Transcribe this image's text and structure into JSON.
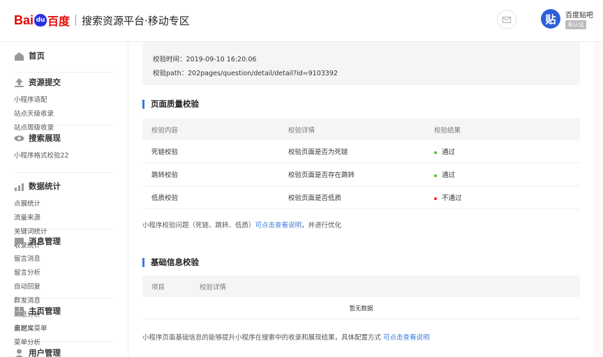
{
  "header": {
    "logo_bai": "Bai",
    "logo_du": "du",
    "logo_cn": "百度",
    "platform_title": "搜索资源平台·移动专区",
    "user_avatar_char": "贴",
    "user_name": "百度贴吧",
    "user_badge": "未认证"
  },
  "sidebar": {
    "home": "首页",
    "resource": {
      "title": "资源提交",
      "items": [
        "小程序适配",
        "站点天级收录",
        "站点周级收录"
      ]
    },
    "search": {
      "title": "搜索展现",
      "items": [
        "小程序格式校验22"
      ]
    },
    "data": {
      "title": "数据统计",
      "items": [
        "点展统计",
        "流量来源",
        "关键词统计",
        "收录统计"
      ]
    },
    "message": {
      "title": "消息管理",
      "items": [
        "留言消息",
        "留言分析",
        "自动回复",
        "群发消息",
        "消息分析",
        "素材库"
      ]
    },
    "homepage": {
      "title": "主页管理",
      "items": [
        "自定义菜单",
        "菜单分析"
      ]
    },
    "user": {
      "title": "用户管理"
    }
  },
  "main": {
    "check_time_label": "校验时间：",
    "check_time_value": "2019-09-10 16:20:06",
    "check_path_label": "校验path：",
    "check_path_value": "202pages/question/detail/detail?id=9103392",
    "quality": {
      "title": "页面质量校验",
      "columns": [
        "校验内容",
        "校验详情",
        "校验结果"
      ],
      "rows": [
        {
          "content": "死链校验",
          "detail": "校验页面是否为死链",
          "result": "通过",
          "status": "pass"
        },
        {
          "content": "跳转校验",
          "detail": "校验页面是否存在跳转",
          "result": "通过",
          "status": "pass"
        },
        {
          "content": "低质校验",
          "detail": "校验页面是否低质",
          "result": "不通过",
          "status": "fail"
        }
      ],
      "note_prefix": "小程序校验问题（死链、跳转、低质）",
      "note_link": "可点击查看说明",
      "note_suffix": "，并进行优化"
    },
    "basic": {
      "title": "基础信息校验",
      "columns": [
        "项目",
        "校验详情"
      ],
      "empty_text": "暂无数据",
      "note_prefix": "小程序页面基础信息的能够提升小程序在搜索中的收录和展现结果，具体配置方式",
      "note_link": "可点击查看说明"
    }
  },
  "colors": {
    "pass": "#52c41a",
    "fail": "#f5222d",
    "link": "#3b7bde",
    "brand_red": "#e10601",
    "brand_blue": "#2932e1"
  }
}
